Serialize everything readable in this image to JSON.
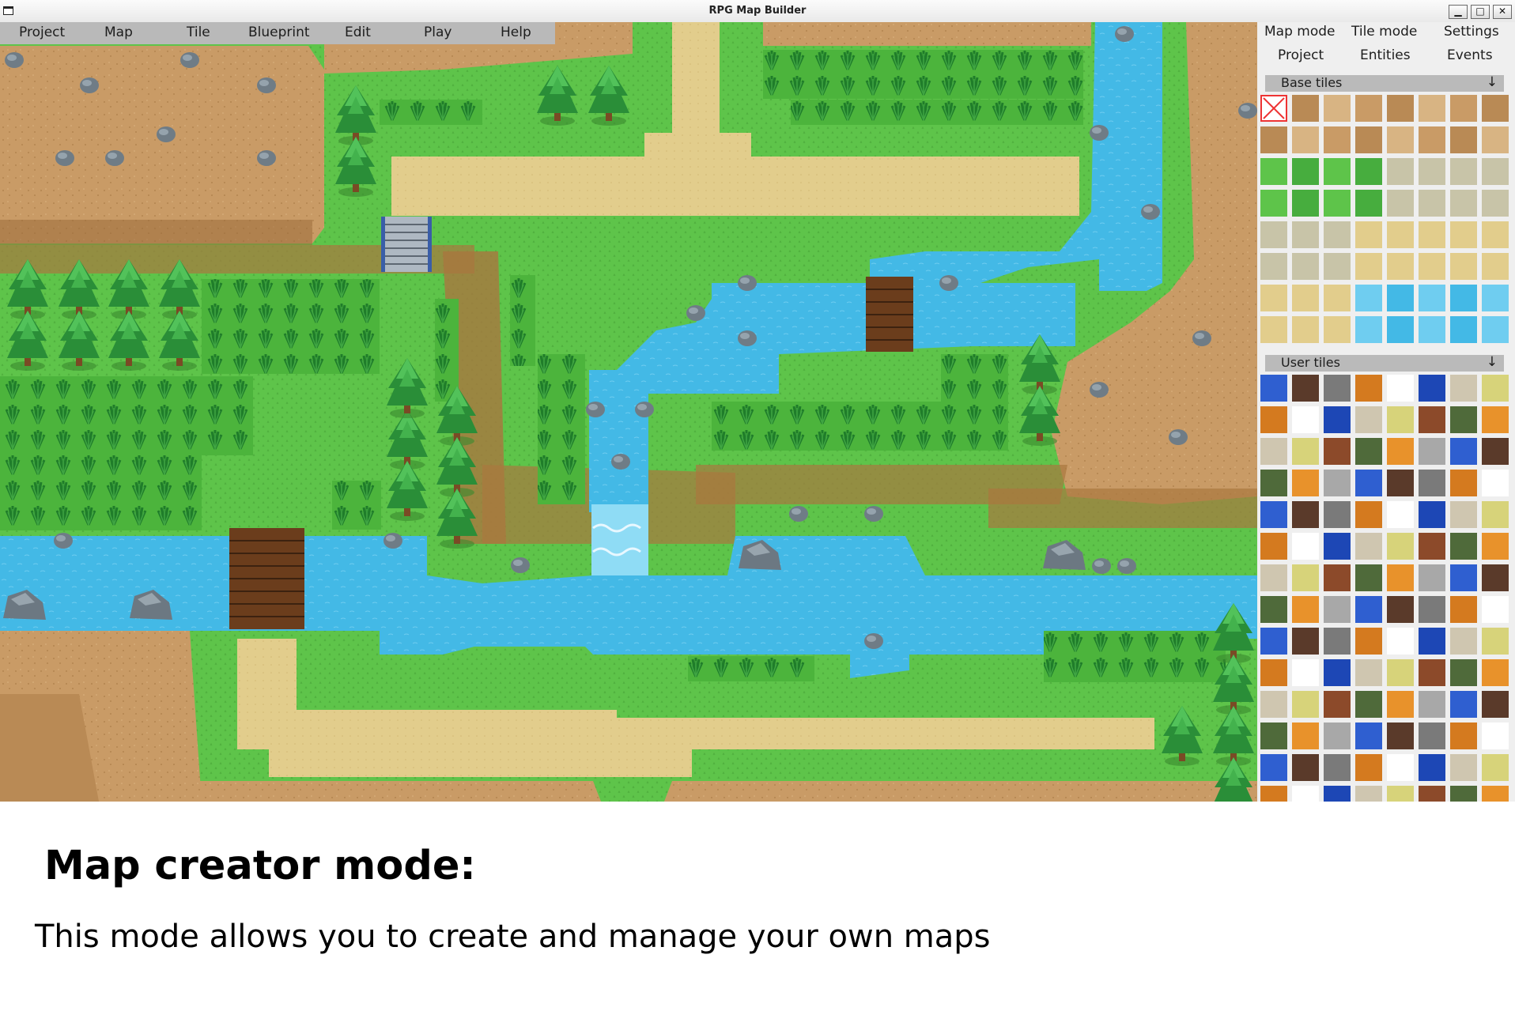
{
  "window": {
    "title": "RPG Map Builder",
    "controls": {
      "minimize": "▁",
      "maximize": "□",
      "close": "✕"
    }
  },
  "menubar": {
    "items": [
      "Project",
      "Map",
      "Tile",
      "Blueprint",
      "Edit",
      "Play",
      "Help"
    ]
  },
  "panel": {
    "color_swatch": "#6b6b6b",
    "mode_row1": [
      "Map mode",
      "Tile mode",
      "Settings"
    ],
    "mode_row2": [
      "Project",
      "Entities",
      "Events"
    ],
    "base_tiles_label": "Base tiles",
    "user_tiles_label": "User tiles",
    "collapse_icon": "arrow-down-icon"
  },
  "caption": {
    "title": "Map creator mode:",
    "body": "This mode allows you to create and manage your own maps"
  },
  "colors": {
    "grass": "#5ec44a",
    "cliff": "#c89a66",
    "water": "#43b9e6",
    "path": "#e2cd8c",
    "tree": "#2f9b3a"
  }
}
